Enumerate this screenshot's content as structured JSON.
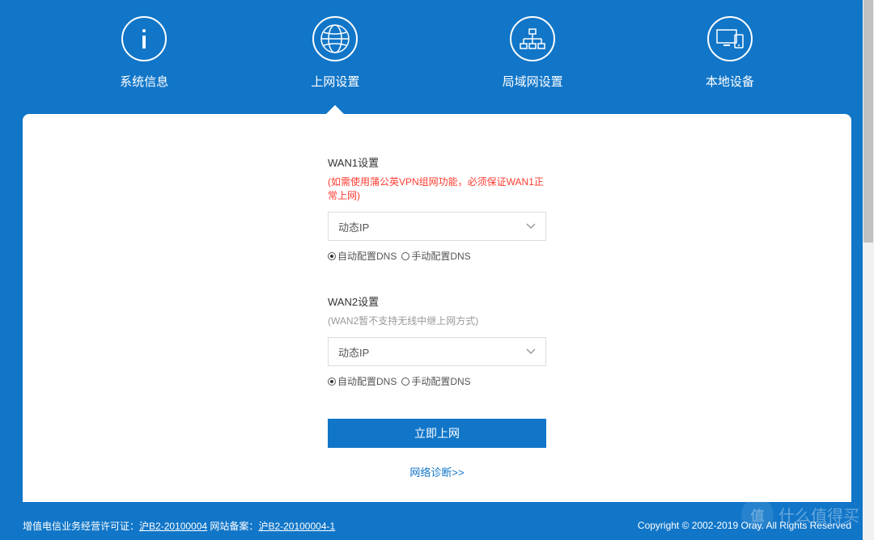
{
  "tabs": [
    {
      "label": "系统信息",
      "icon": "info"
    },
    {
      "label": "上网设置",
      "icon": "globe",
      "active": true
    },
    {
      "label": "局域网设置",
      "icon": "network"
    },
    {
      "label": "本地设备",
      "icon": "devices"
    }
  ],
  "wan1": {
    "title": "WAN1设置",
    "note": "(如需使用蒲公英VPN组网功能，必须保证WAN1正常上网)",
    "mode": "动态IP",
    "dns_auto": "自动配置DNS",
    "dns_manual": "手动配置DNS",
    "selected": "auto"
  },
  "wan2": {
    "title": "WAN2设置",
    "note": "(WAN2暂不支持无线中继上网方式)",
    "mode": "动态IP",
    "dns_auto": "自动配置DNS",
    "dns_manual": "手动配置DNS",
    "selected": "auto"
  },
  "submit_label": "立即上网",
  "diag_link": "网络诊断>>",
  "footer": {
    "left_prefix": "增值电信业务经营许可证：",
    "license1": "沪B2-20100004",
    "mid": " 网站备案：",
    "license2": "沪B2-20100004-1",
    "right": "Copyright © 2002-2019 Oray. All Rights Reserved"
  },
  "watermark": {
    "badge": "值",
    "text": "什么值得买"
  }
}
